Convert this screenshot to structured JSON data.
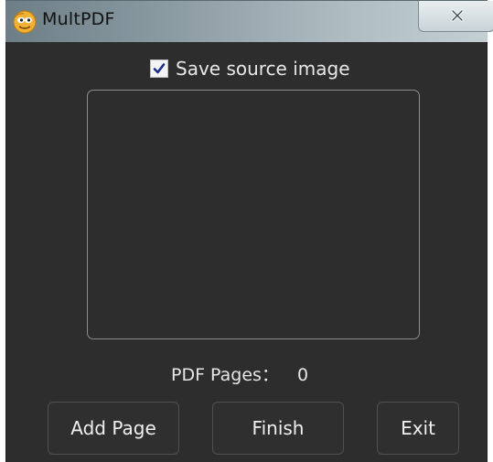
{
  "window": {
    "title": "MultPDF",
    "close_label": "Close"
  },
  "options": {
    "save_source_image_label": "Save source image",
    "save_source_image_checked": true
  },
  "status": {
    "pages_label": "PDF Pages：",
    "pages_count": "0"
  },
  "buttons": {
    "add_page": "Add Page",
    "finish": "Finish",
    "exit": "Exit"
  },
  "icons": {
    "app": "multpdf-app-icon",
    "close": "close-icon",
    "check": "check-icon"
  },
  "colors": {
    "background": "#2d2d2d",
    "text": "#e8e8e8",
    "accent": "#f2b134"
  }
}
